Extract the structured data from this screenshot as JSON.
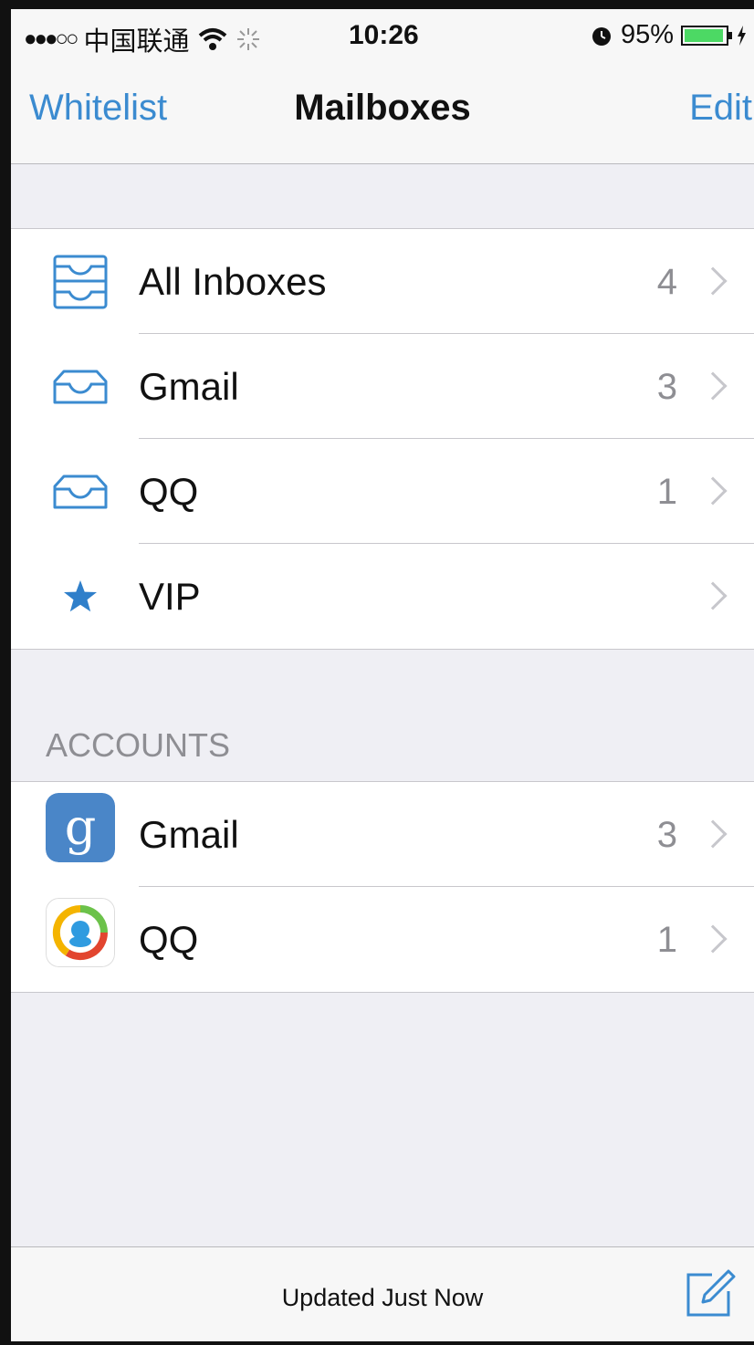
{
  "status_bar": {
    "signal_dots": "●●●○○",
    "carrier": "中国联通",
    "time": "10:26",
    "battery_percent": "95%",
    "battery_level": 0.95
  },
  "navbar": {
    "left_button": "Whitelist",
    "title": "Mailboxes",
    "right_button": "Edit"
  },
  "mailboxes": [
    {
      "label": "All Inboxes",
      "count": "4",
      "icon": "all-inboxes-icon"
    },
    {
      "label": "Gmail",
      "count": "3",
      "icon": "inbox-tray-icon"
    },
    {
      "label": "QQ",
      "count": "1",
      "icon": "inbox-tray-icon"
    },
    {
      "label": "VIP",
      "count": "",
      "icon": "star-icon"
    }
  ],
  "accounts_header": "ACCOUNTS",
  "accounts": [
    {
      "label": "Gmail",
      "count": "3",
      "icon": "gmail-app-icon"
    },
    {
      "label": "QQ",
      "count": "1",
      "icon": "qq-app-icon"
    }
  ],
  "toolbar": {
    "status_text": "Updated Just Now",
    "compose_icon": "compose-icon"
  },
  "colors": {
    "accent": "#3b8bd0",
    "background": "#efeff4",
    "count_gray": "#8e8e93"
  }
}
